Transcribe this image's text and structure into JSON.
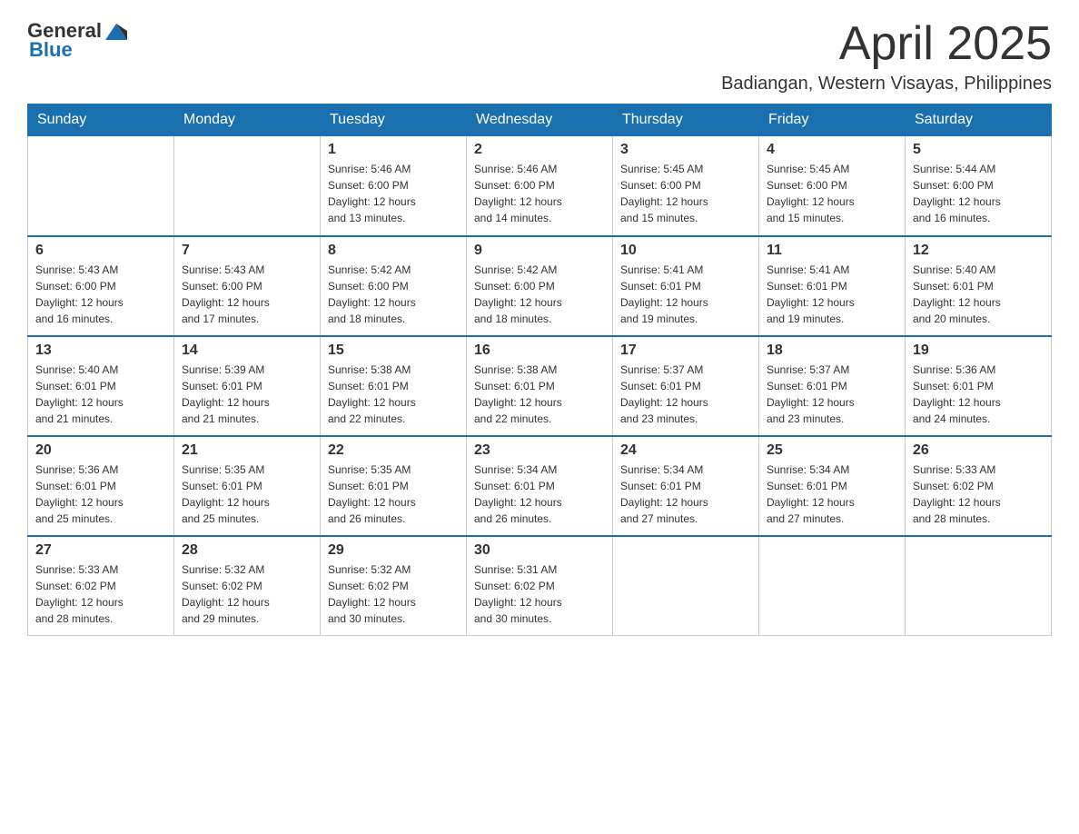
{
  "header": {
    "logo_general": "General",
    "logo_blue": "Blue",
    "month_title": "April 2025",
    "location": "Badiangan, Western Visayas, Philippines"
  },
  "weekdays": [
    "Sunday",
    "Monday",
    "Tuesday",
    "Wednesday",
    "Thursday",
    "Friday",
    "Saturday"
  ],
  "weeks": [
    [
      {
        "day": "",
        "info": ""
      },
      {
        "day": "",
        "info": ""
      },
      {
        "day": "1",
        "info": "Sunrise: 5:46 AM\nSunset: 6:00 PM\nDaylight: 12 hours\nand 13 minutes."
      },
      {
        "day": "2",
        "info": "Sunrise: 5:46 AM\nSunset: 6:00 PM\nDaylight: 12 hours\nand 14 minutes."
      },
      {
        "day": "3",
        "info": "Sunrise: 5:45 AM\nSunset: 6:00 PM\nDaylight: 12 hours\nand 15 minutes."
      },
      {
        "day": "4",
        "info": "Sunrise: 5:45 AM\nSunset: 6:00 PM\nDaylight: 12 hours\nand 15 minutes."
      },
      {
        "day": "5",
        "info": "Sunrise: 5:44 AM\nSunset: 6:00 PM\nDaylight: 12 hours\nand 16 minutes."
      }
    ],
    [
      {
        "day": "6",
        "info": "Sunrise: 5:43 AM\nSunset: 6:00 PM\nDaylight: 12 hours\nand 16 minutes."
      },
      {
        "day": "7",
        "info": "Sunrise: 5:43 AM\nSunset: 6:00 PM\nDaylight: 12 hours\nand 17 minutes."
      },
      {
        "day": "8",
        "info": "Sunrise: 5:42 AM\nSunset: 6:00 PM\nDaylight: 12 hours\nand 18 minutes."
      },
      {
        "day": "9",
        "info": "Sunrise: 5:42 AM\nSunset: 6:00 PM\nDaylight: 12 hours\nand 18 minutes."
      },
      {
        "day": "10",
        "info": "Sunrise: 5:41 AM\nSunset: 6:01 PM\nDaylight: 12 hours\nand 19 minutes."
      },
      {
        "day": "11",
        "info": "Sunrise: 5:41 AM\nSunset: 6:01 PM\nDaylight: 12 hours\nand 19 minutes."
      },
      {
        "day": "12",
        "info": "Sunrise: 5:40 AM\nSunset: 6:01 PM\nDaylight: 12 hours\nand 20 minutes."
      }
    ],
    [
      {
        "day": "13",
        "info": "Sunrise: 5:40 AM\nSunset: 6:01 PM\nDaylight: 12 hours\nand 21 minutes."
      },
      {
        "day": "14",
        "info": "Sunrise: 5:39 AM\nSunset: 6:01 PM\nDaylight: 12 hours\nand 21 minutes."
      },
      {
        "day": "15",
        "info": "Sunrise: 5:38 AM\nSunset: 6:01 PM\nDaylight: 12 hours\nand 22 minutes."
      },
      {
        "day": "16",
        "info": "Sunrise: 5:38 AM\nSunset: 6:01 PM\nDaylight: 12 hours\nand 22 minutes."
      },
      {
        "day": "17",
        "info": "Sunrise: 5:37 AM\nSunset: 6:01 PM\nDaylight: 12 hours\nand 23 minutes."
      },
      {
        "day": "18",
        "info": "Sunrise: 5:37 AM\nSunset: 6:01 PM\nDaylight: 12 hours\nand 23 minutes."
      },
      {
        "day": "19",
        "info": "Sunrise: 5:36 AM\nSunset: 6:01 PM\nDaylight: 12 hours\nand 24 minutes."
      }
    ],
    [
      {
        "day": "20",
        "info": "Sunrise: 5:36 AM\nSunset: 6:01 PM\nDaylight: 12 hours\nand 25 minutes."
      },
      {
        "day": "21",
        "info": "Sunrise: 5:35 AM\nSunset: 6:01 PM\nDaylight: 12 hours\nand 25 minutes."
      },
      {
        "day": "22",
        "info": "Sunrise: 5:35 AM\nSunset: 6:01 PM\nDaylight: 12 hours\nand 26 minutes."
      },
      {
        "day": "23",
        "info": "Sunrise: 5:34 AM\nSunset: 6:01 PM\nDaylight: 12 hours\nand 26 minutes."
      },
      {
        "day": "24",
        "info": "Sunrise: 5:34 AM\nSunset: 6:01 PM\nDaylight: 12 hours\nand 27 minutes."
      },
      {
        "day": "25",
        "info": "Sunrise: 5:34 AM\nSunset: 6:01 PM\nDaylight: 12 hours\nand 27 minutes."
      },
      {
        "day": "26",
        "info": "Sunrise: 5:33 AM\nSunset: 6:02 PM\nDaylight: 12 hours\nand 28 minutes."
      }
    ],
    [
      {
        "day": "27",
        "info": "Sunrise: 5:33 AM\nSunset: 6:02 PM\nDaylight: 12 hours\nand 28 minutes."
      },
      {
        "day": "28",
        "info": "Sunrise: 5:32 AM\nSunset: 6:02 PM\nDaylight: 12 hours\nand 29 minutes."
      },
      {
        "day": "29",
        "info": "Sunrise: 5:32 AM\nSunset: 6:02 PM\nDaylight: 12 hours\nand 30 minutes."
      },
      {
        "day": "30",
        "info": "Sunrise: 5:31 AM\nSunset: 6:02 PM\nDaylight: 12 hours\nand 30 minutes."
      },
      {
        "day": "",
        "info": ""
      },
      {
        "day": "",
        "info": ""
      },
      {
        "day": "",
        "info": ""
      }
    ]
  ]
}
